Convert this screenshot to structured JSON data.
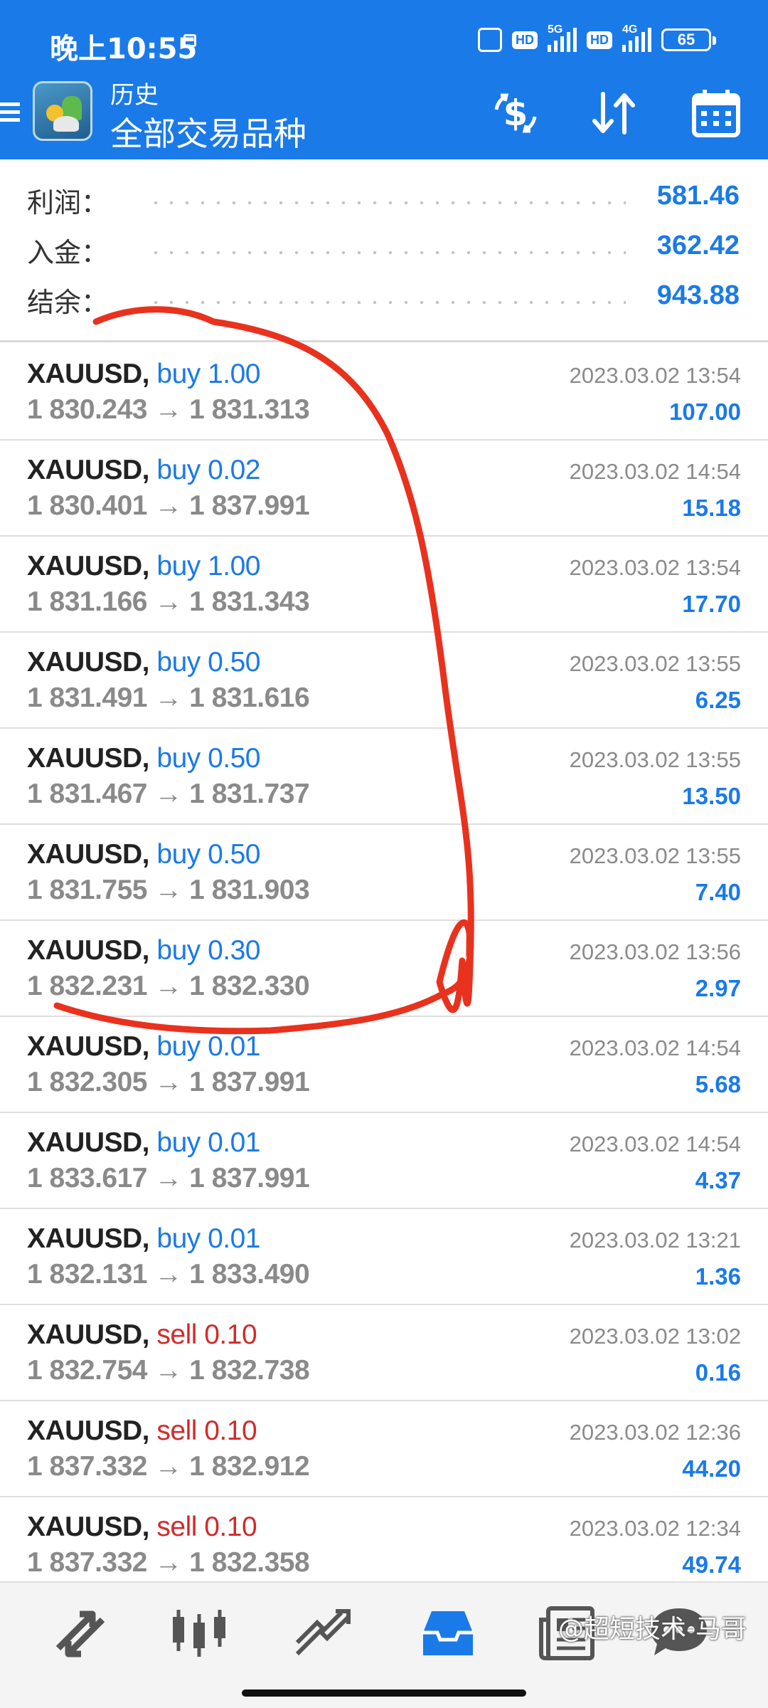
{
  "status_bar": {
    "time": "晚上10:55",
    "hd1": "HD",
    "net1": "5G",
    "hd2": "HD",
    "net2": "4G",
    "battery": "65"
  },
  "app_bar": {
    "title": "历史",
    "subtitle": "全部交易品种",
    "icons": [
      "menu-icon",
      "app-logo",
      "balance-exchange-icon",
      "sort-icon",
      "calendar-icon"
    ]
  },
  "summary": [
    {
      "label": "利润：",
      "value": "581.46"
    },
    {
      "label": "入金：",
      "value": "362.42"
    },
    {
      "label": "结余：",
      "value": "943.88"
    }
  ],
  "trades": [
    {
      "symbol": "XAUUSD,",
      "side": "buy",
      "lot": "buy 1.00",
      "prices": "1 830.243 → 1 831.313",
      "time": "2023.03.02 13:54",
      "profit": "107.00"
    },
    {
      "symbol": "XAUUSD,",
      "side": "buy",
      "lot": "buy 0.02",
      "prices": "1 830.401 → 1 837.991",
      "time": "2023.03.02 14:54",
      "profit": "15.18"
    },
    {
      "symbol": "XAUUSD,",
      "side": "buy",
      "lot": "buy 1.00",
      "prices": "1 831.166 → 1 831.343",
      "time": "2023.03.02 13:54",
      "profit": "17.70"
    },
    {
      "symbol": "XAUUSD,",
      "side": "buy",
      "lot": "buy 0.50",
      "prices": "1 831.491 → 1 831.616",
      "time": "2023.03.02 13:55",
      "profit": "6.25"
    },
    {
      "symbol": "XAUUSD,",
      "side": "buy",
      "lot": "buy 0.50",
      "prices": "1 831.467 → 1 831.737",
      "time": "2023.03.02 13:55",
      "profit": "13.50"
    },
    {
      "symbol": "XAUUSD,",
      "side": "buy",
      "lot": "buy 0.50",
      "prices": "1 831.755 → 1 831.903",
      "time": "2023.03.02 13:55",
      "profit": "7.40"
    },
    {
      "symbol": "XAUUSD,",
      "side": "buy",
      "lot": "buy 0.30",
      "prices": "1 832.231 → 1 832.330",
      "time": "2023.03.02 13:56",
      "profit": "2.97"
    },
    {
      "symbol": "XAUUSD,",
      "side": "buy",
      "lot": "buy 0.01",
      "prices": "1 832.305 → 1 837.991",
      "time": "2023.03.02 14:54",
      "profit": "5.68"
    },
    {
      "symbol": "XAUUSD,",
      "side": "buy",
      "lot": "buy 0.01",
      "prices": "1 833.617 → 1 837.991",
      "time": "2023.03.02 14:54",
      "profit": "4.37"
    },
    {
      "symbol": "XAUUSD,",
      "side": "buy",
      "lot": "buy 0.01",
      "prices": "1 832.131 → 1 833.490",
      "time": "2023.03.02 13:21",
      "profit": "1.36"
    },
    {
      "symbol": "XAUUSD,",
      "side": "sell",
      "lot": "sell 0.10",
      "prices": "1 832.754 → 1 832.738",
      "time": "2023.03.02 13:02",
      "profit": "0.16"
    },
    {
      "symbol": "XAUUSD,",
      "side": "sell",
      "lot": "sell 0.10",
      "prices": "1 837.332 → 1 832.912",
      "time": "2023.03.02 12:36",
      "profit": "44.20"
    },
    {
      "symbol": "XAUUSD,",
      "side": "sell",
      "lot": "sell 0.10",
      "prices": "1 837.332 → 1 832.358",
      "time": "2023.03.02 12:34",
      "profit": "49.74"
    }
  ],
  "bottom_nav": {
    "items": [
      "quotes-icon",
      "chart-icon",
      "trade-icon",
      "history-icon",
      "news-icon",
      "messages-icon"
    ],
    "active": "history-icon"
  },
  "watermark": "@超短技术-马哥",
  "colors": {
    "primary": "#1a7ae8",
    "sell": "#d12b2b",
    "annotation": "#e8321e"
  }
}
